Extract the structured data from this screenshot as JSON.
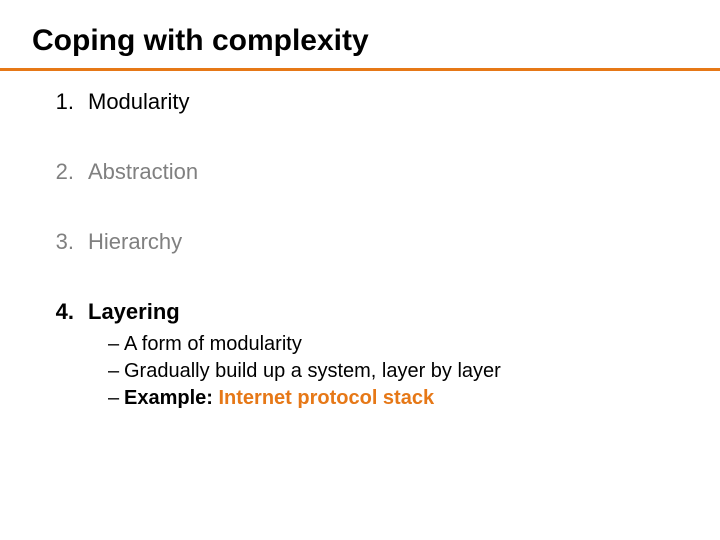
{
  "title": "Coping with complexity",
  "items": [
    {
      "n": "1.",
      "label": "Modularity",
      "dim": false,
      "bold": false
    },
    {
      "n": "2.",
      "label": "Abstraction",
      "dim": true,
      "bold": false
    },
    {
      "n": "3.",
      "label": "Hierarchy",
      "dim": true,
      "bold": false
    },
    {
      "n": "4.",
      "label": "Layering",
      "dim": false,
      "bold": true
    }
  ],
  "sub": [
    {
      "dash": "–",
      "text": "A form of modularity"
    },
    {
      "dash": "–",
      "text": "Gradually build up a system, layer by layer"
    },
    {
      "dash": "–",
      "prefix": "Example: ",
      "accent": "Internet protocol stack"
    }
  ]
}
